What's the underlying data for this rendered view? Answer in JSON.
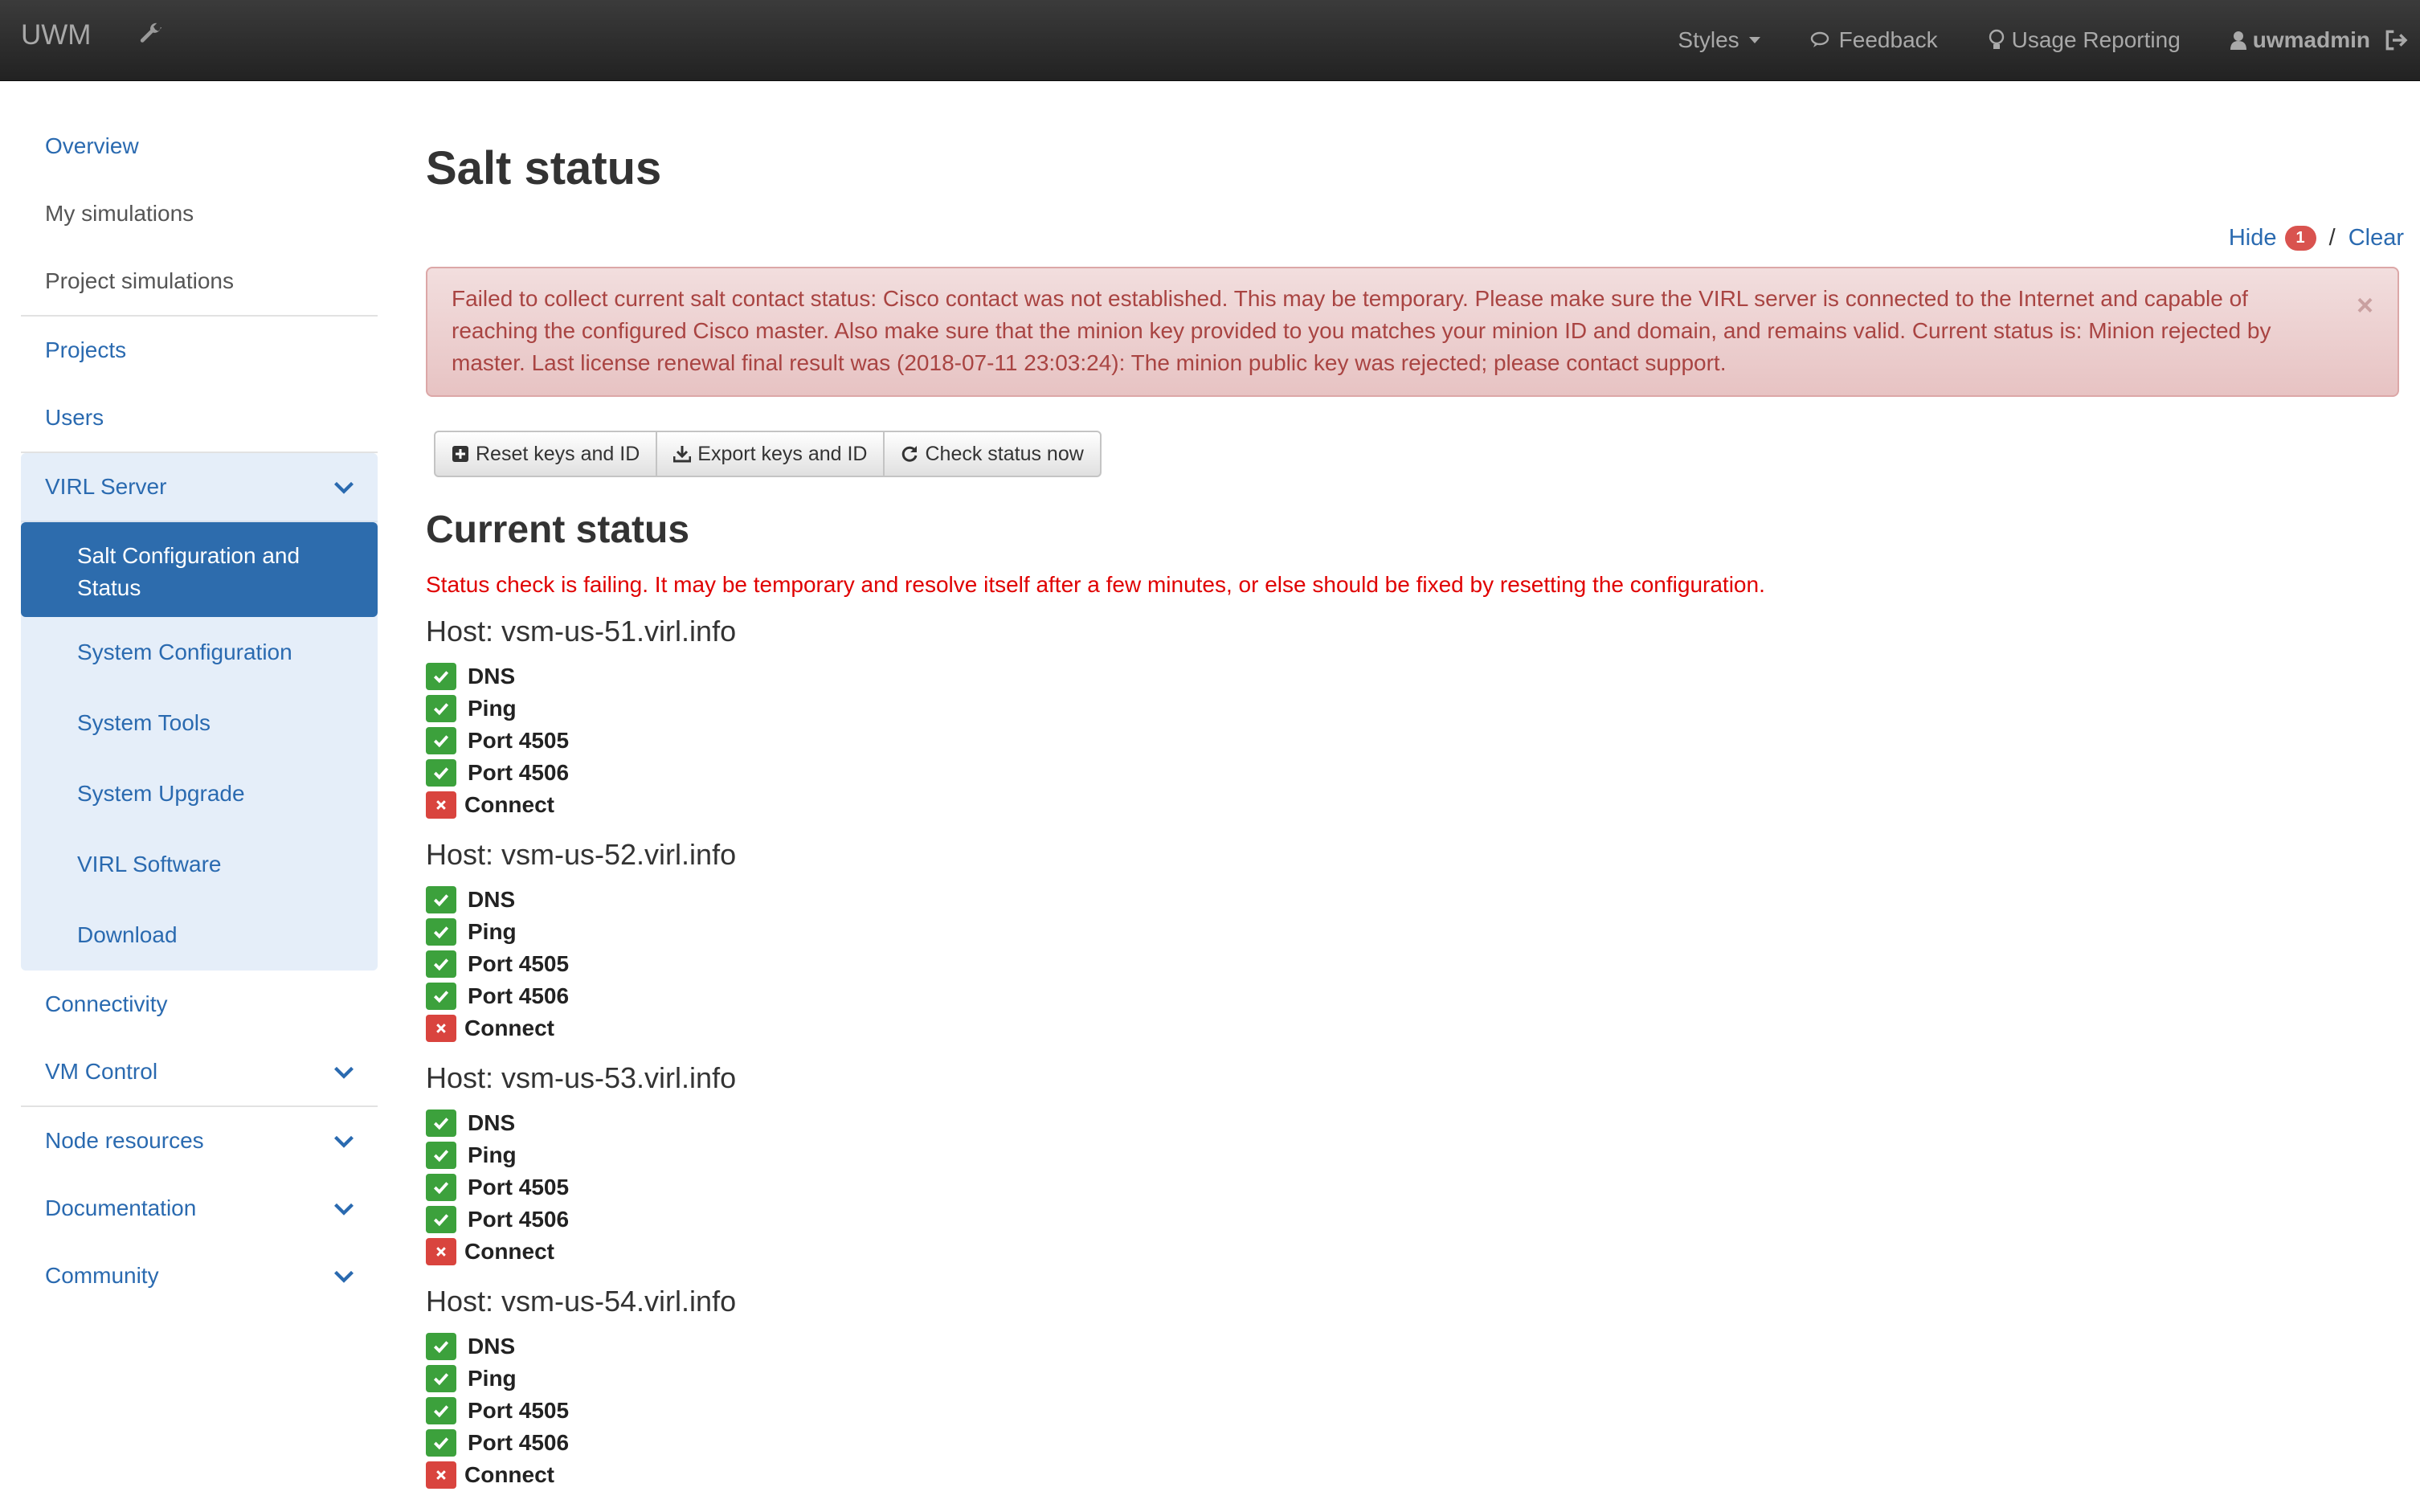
{
  "navbar": {
    "brand": "UWM",
    "styles_label": "Styles",
    "feedback_label": "Feedback",
    "usage_label": "Usage Reporting",
    "user_label": "uwmadmin"
  },
  "sidebar": {
    "overview": "Overview",
    "my_simulations": "My simulations",
    "project_simulations": "Project simulations",
    "projects": "Projects",
    "users": "Users",
    "virl_server": "VIRL Server",
    "salt_config": "Salt Configuration and Status",
    "system_configuration": "System Configuration",
    "system_tools": "System Tools",
    "system_upgrade": "System Upgrade",
    "virl_software": "VIRL Software",
    "download": "Download",
    "connectivity": "Connectivity",
    "vm_control": "VM Control",
    "node_resources": "Node resources",
    "documentation": "Documentation",
    "community": "Community"
  },
  "main": {
    "title": "Salt status",
    "hide_label": "Hide",
    "hide_count": "1",
    "clear_label": "Clear",
    "alert_text": "Failed to collect current salt contact status: Cisco contact was not established. This may be temporary. Please make sure the VIRL server is connected to the Internet and capable of reaching the configured Cisco master. Also make sure that the minion key provided to you matches your minion ID and domain, and remains valid. Current status is: Minion rejected by master. Last license renewal final result was (2018-07-11 23:03:24): The minion public key was rejected; please contact support.",
    "buttons": {
      "reset": "Reset keys and ID",
      "export": "Export keys and ID",
      "check": "Check status now"
    },
    "current_status_title": "Current status",
    "status_message": "Status check is failing. It may be temporary and resolve itself after a few minutes, or else should be fixed by resetting the configuration.",
    "hosts": [
      {
        "title": "Host: vsm-us-51.virl.info",
        "checks": [
          {
            "label": "DNS",
            "status": "ok"
          },
          {
            "label": "Ping",
            "status": "ok"
          },
          {
            "label": "Port 4505",
            "status": "ok"
          },
          {
            "label": "Port 4506",
            "status": "ok"
          },
          {
            "label": "Connect",
            "status": "fail"
          }
        ]
      },
      {
        "title": "Host: vsm-us-52.virl.info",
        "checks": [
          {
            "label": "DNS",
            "status": "ok"
          },
          {
            "label": "Ping",
            "status": "ok"
          },
          {
            "label": "Port 4505",
            "status": "ok"
          },
          {
            "label": "Port 4506",
            "status": "ok"
          },
          {
            "label": "Connect",
            "status": "fail"
          }
        ]
      },
      {
        "title": "Host: vsm-us-53.virl.info",
        "checks": [
          {
            "label": "DNS",
            "status": "ok"
          },
          {
            "label": "Ping",
            "status": "ok"
          },
          {
            "label": "Port 4505",
            "status": "ok"
          },
          {
            "label": "Port 4506",
            "status": "ok"
          },
          {
            "label": "Connect",
            "status": "fail"
          }
        ]
      },
      {
        "title": "Host: vsm-us-54.virl.info",
        "checks": [
          {
            "label": "DNS",
            "status": "ok"
          },
          {
            "label": "Ping",
            "status": "ok"
          },
          {
            "label": "Port 4505",
            "status": "ok"
          },
          {
            "label": "Port 4506",
            "status": "ok"
          },
          {
            "label": "Connect",
            "status": "fail"
          }
        ]
      }
    ]
  },
  "colors": {
    "navbar_bg": "#2b2b2b",
    "link": "#2a6ab0",
    "active_nav": "#2d6cad",
    "alert_bg": "#f2dede",
    "alert_text": "#a94442",
    "status_error": "#e00000",
    "check_ok": "#3ca13c",
    "check_fail": "#d9443e"
  },
  "icons": [
    "wrench-icon",
    "caret-down-icon",
    "comments-icon",
    "lightbulb-icon",
    "user-icon",
    "logout-icon",
    "chevron-down-icon",
    "plus-square-icon",
    "download-icon",
    "refresh-icon",
    "check-icon",
    "times-icon",
    "close-icon"
  ]
}
